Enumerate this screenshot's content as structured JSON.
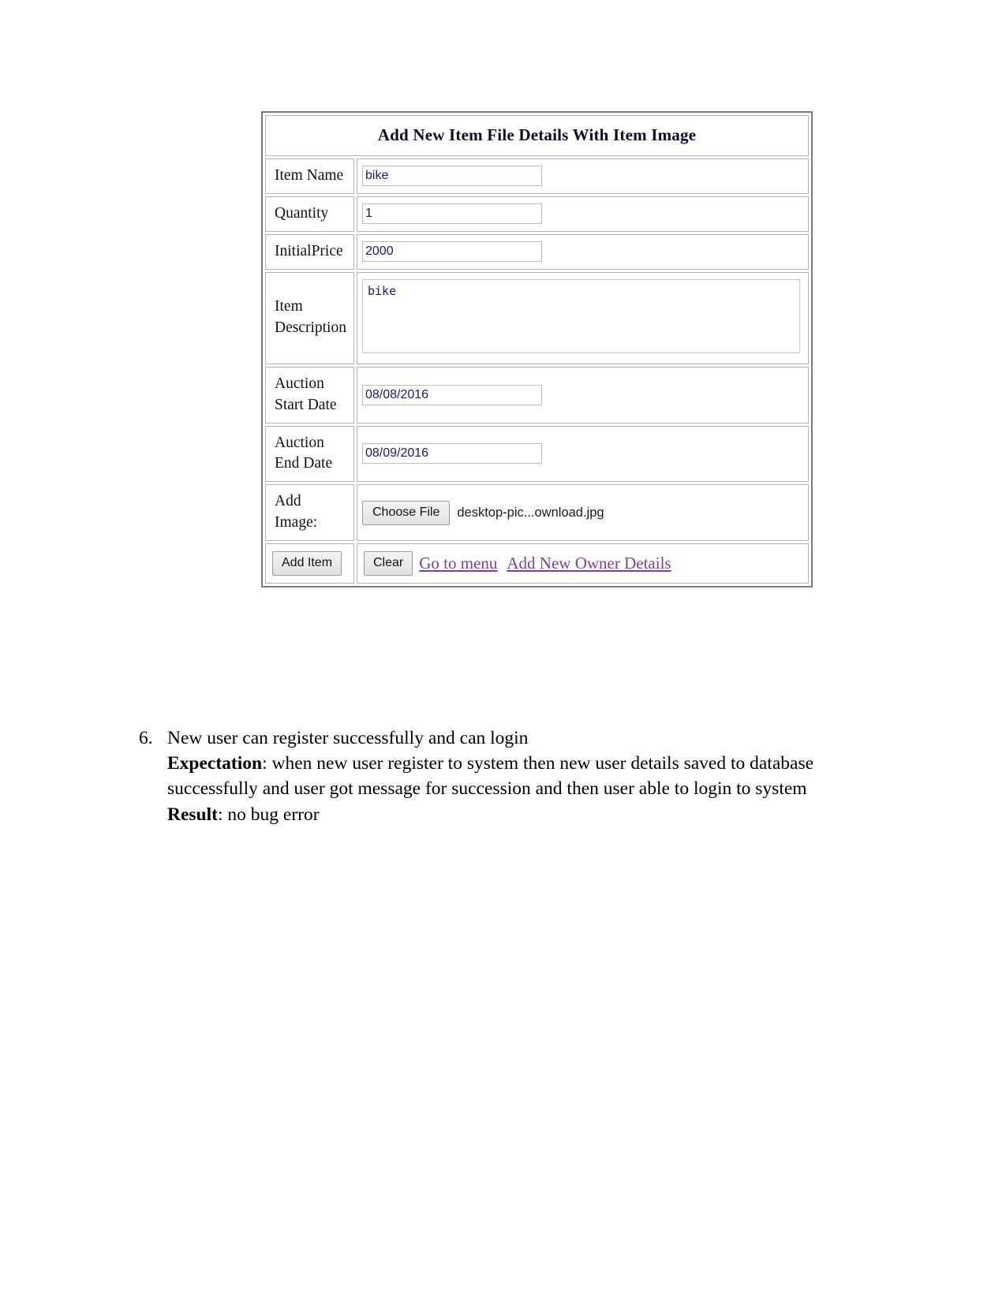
{
  "form": {
    "title": "Add New Item File Details With Item Image",
    "rows": [
      {
        "label_line1": "Item Name",
        "label_line2": "",
        "value": "bike"
      },
      {
        "label_line1": "Quantity",
        "label_line2": "",
        "value": "1"
      },
      {
        "label_line1": "InitialPrice",
        "label_line2": "",
        "value": "2000"
      },
      {
        "label_line1": "Item",
        "label_line2": "Description",
        "value": "bike"
      },
      {
        "label_line1": "Auction",
        "label_line2": "Start Date",
        "value": "08/08/2016"
      },
      {
        "label_line1": "Auction",
        "label_line2": "End Date",
        "value": "08/09/2016"
      },
      {
        "label_line1": "Add",
        "label_line2": "Image:",
        "value": ""
      }
    ],
    "file": {
      "choose_button": "Choose File",
      "file_name": "desktop-pic...ownload.jpg"
    },
    "actions": {
      "add_item_button": "Add Item",
      "clear_button": "Clear",
      "go_to_menu_link": "Go to menu",
      "add_owner_link": "Add New Owner Details"
    },
    "colors": {
      "link": "#7c3f9e",
      "input_text": "#1a1a6e",
      "border": "#7a7a7a"
    }
  },
  "document": {
    "item_number": "6.",
    "item_title": "New user can register successfully and can login",
    "expectation_label": "Expectation",
    "expectation_text": ": when new user register to system then new user details saved to database successfully and user got message for succession and then user able to login to system",
    "result_label": "Result",
    "result_text": ": no bug error"
  }
}
